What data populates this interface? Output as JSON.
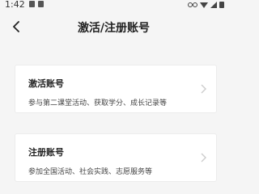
{
  "status_bar": {
    "time": "1:42",
    "right_icons": [
      "link-icon",
      "wifi-icon",
      "signal-icon",
      "battery-icon"
    ]
  },
  "header": {
    "title": "激活/注册账号",
    "back_icon": "chevron-left-icon"
  },
  "options": [
    {
      "title": "激活账号",
      "description": "参与第二课堂活动、获取学分、成长记录等"
    },
    {
      "title": "注册账号",
      "description": "参加全国活动、社会实践、志愿服务等"
    }
  ],
  "colors": {
    "background": "#f5f5f5",
    "card": "#ffffff",
    "chevron": "#cccccc"
  }
}
